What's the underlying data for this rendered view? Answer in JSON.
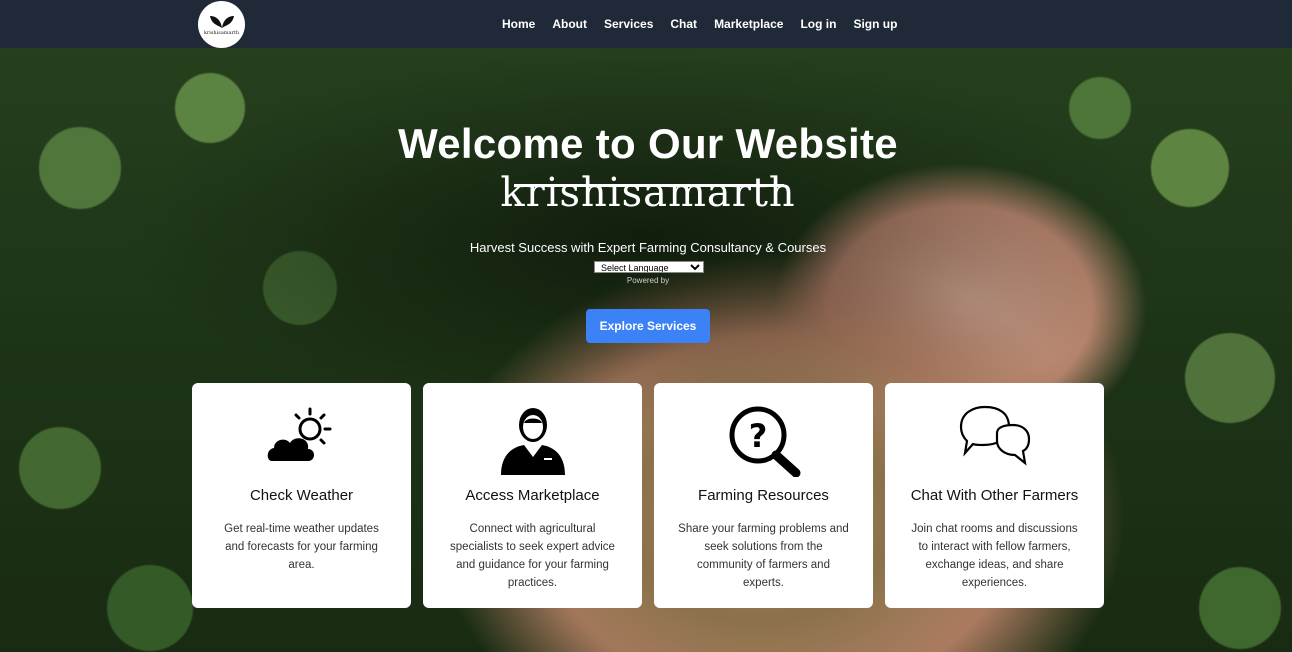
{
  "nav": {
    "logo_text": "krishisamarth",
    "links": [
      "Home",
      "About",
      "Services",
      "Chat",
      "Marketplace",
      "Log in",
      "Sign up"
    ]
  },
  "hero": {
    "title": "Welcome to Our Website",
    "brand": "krishisamarth",
    "tagline": "Harvest Success with Expert Farming Consultancy & Courses",
    "language_select": "Select Language",
    "powered_by": "Powered by",
    "cta_label": "Explore Services"
  },
  "cards": [
    {
      "icon": "weather-icon",
      "title": "Check Weather",
      "description": "Get real-time weather updates and forecasts for your farming area."
    },
    {
      "icon": "specialist-icon",
      "title": "Access Marketplace",
      "description": "Connect with agricultural specialists to seek expert advice and guidance for your farming practices."
    },
    {
      "icon": "question-search-icon",
      "title": "Farming Resources",
      "description": "Share your farming problems and seek solutions from the community of farmers and experts."
    },
    {
      "icon": "chat-bubbles-icon",
      "title": "Chat With Other Farmers",
      "description": "Join chat rooms and discussions to interact with fellow farmers, exchange ideas, and share experiences."
    }
  ],
  "colors": {
    "navbar": "#1f2937",
    "button": "#3b82f6",
    "card": "#ffffff"
  }
}
